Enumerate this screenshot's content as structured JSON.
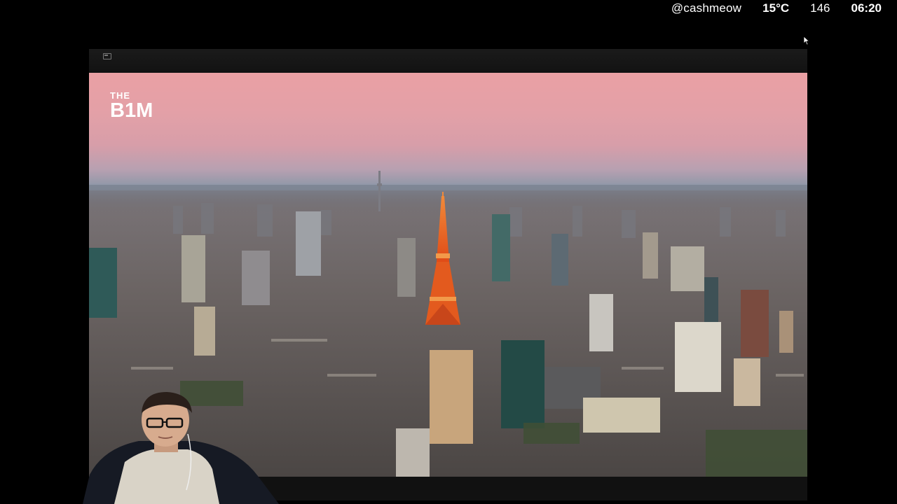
{
  "overlay": {
    "handle": "@cashmeow",
    "temperature": "15°C",
    "count": "146",
    "time": "06:20"
  },
  "video": {
    "brand_top": "THE",
    "brand_main": "B1M",
    "scene": "tokyo-aerial-dusk"
  },
  "icons": {
    "player_topbar": "window-icon",
    "cursor": "mouse-pointer-icon"
  },
  "colors": {
    "sky_top": "#eaa0a4",
    "tower": "#e35a1e",
    "city": "#55504f"
  }
}
